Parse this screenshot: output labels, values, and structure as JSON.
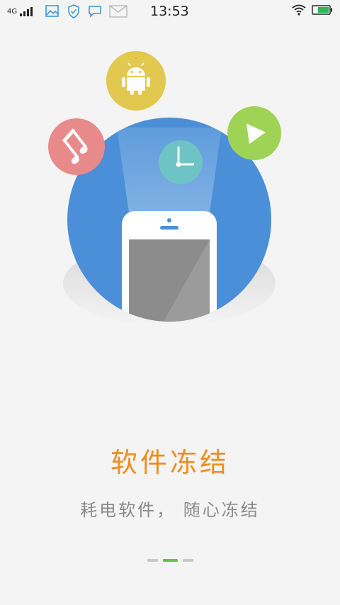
{
  "status_bar": {
    "network": "4G",
    "time": "13:53",
    "icons": [
      "signal-icon",
      "gallery-icon",
      "shield-icon",
      "message-icon",
      "mail-icon",
      "wifi-icon",
      "battery-icon"
    ]
  },
  "illustration": {
    "icons": [
      "music-note-icon",
      "android-icon",
      "clock-icon",
      "play-icon"
    ],
    "colors": {
      "circle": "#4a8fd8",
      "android": "#e2c84e",
      "music": "#e98a8a",
      "play": "#9ed355",
      "clock": "#6ec4c4"
    }
  },
  "onboarding": {
    "title": "软件冻结",
    "subtitle": "耗电软件， 随心冻结",
    "page_count": 3,
    "current_page": 2
  }
}
